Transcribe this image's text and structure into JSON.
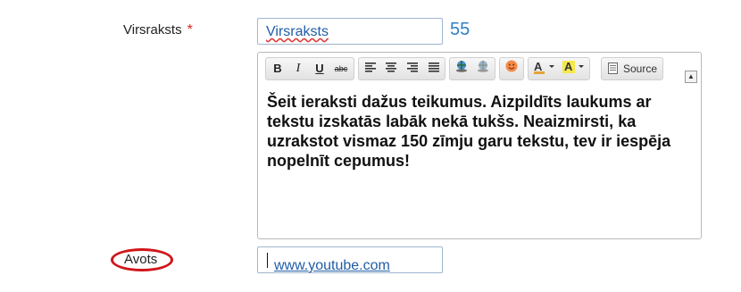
{
  "title_field": {
    "label": "Virsraksts",
    "required_mark": "*",
    "value": "Virsraksts",
    "char_counter": "55"
  },
  "editor": {
    "toolbar": {
      "bold_label": "B",
      "italic_label": "I",
      "underline_label": "U",
      "strike_label": "abc",
      "source_label": "Source",
      "buttons": [
        "bold-icon",
        "italic-icon",
        "underline-icon",
        "strikethrough-icon",
        "align-left-icon",
        "align-center-icon",
        "align-right-icon",
        "align-justify-icon",
        "link-icon",
        "unlink-icon",
        "smiley-icon",
        "text-color-icon",
        "background-color-icon",
        "source-icon"
      ]
    },
    "content": "Šeit ieraksti dažus teikumus. Aizpildīts laukums ar tekstu izskatās labāk nekā tukšs. Neaizmirsti, ka uzrakstot vismaz 150 zīmju garu tekstu, tev ir iespēja nopelnīt cepumus!"
  },
  "source_field": {
    "label": "Avots",
    "value": "www.youtube.com"
  },
  "colors": {
    "counter": "#2f7fc6",
    "required": "#d9251d",
    "highlight_ellipse": "#d0161a"
  }
}
